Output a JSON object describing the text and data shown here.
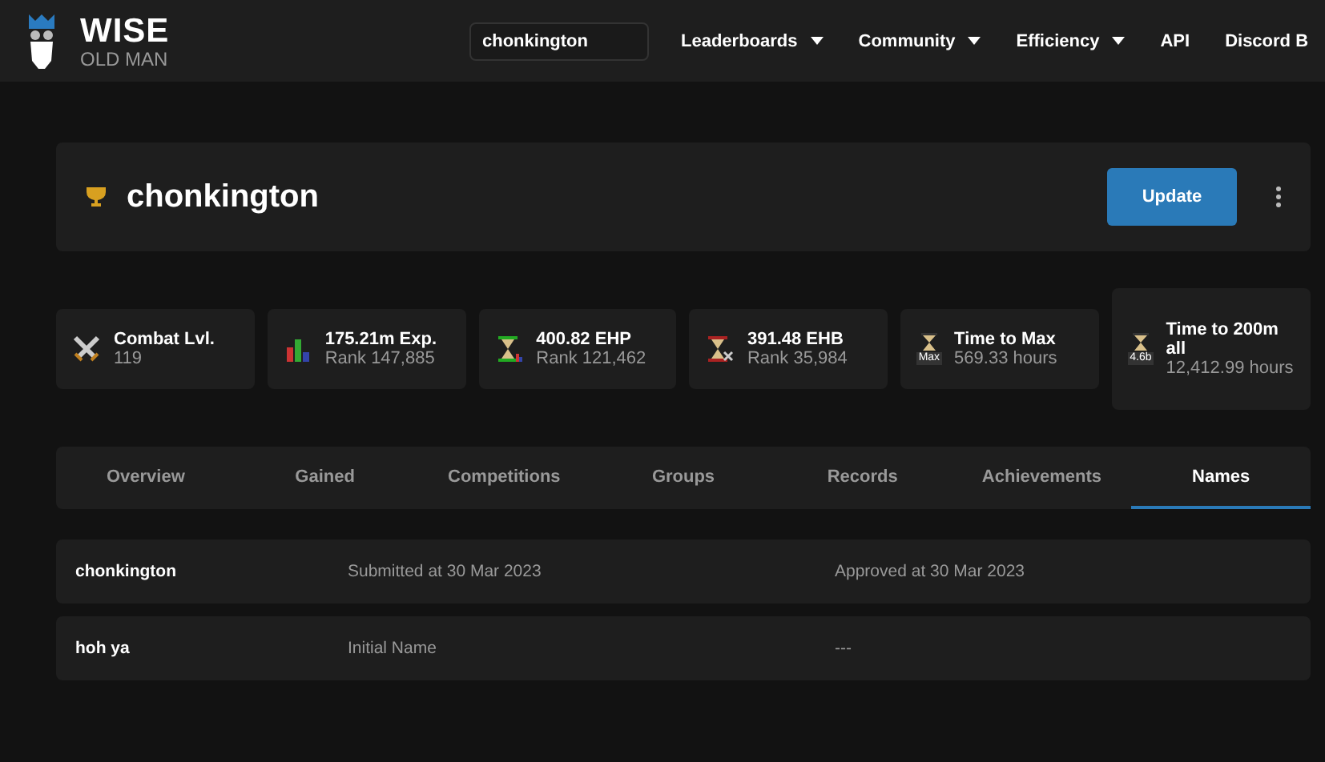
{
  "logo": {
    "title": "WISE",
    "subtitle": "OLD MAN"
  },
  "search": {
    "value": "chonkington"
  },
  "nav": [
    {
      "label": "Leaderboards",
      "dropdown": true
    },
    {
      "label": "Community",
      "dropdown": true
    },
    {
      "label": "Efficiency",
      "dropdown": true
    },
    {
      "label": "API",
      "dropdown": false
    },
    {
      "label": "Discord B",
      "dropdown": false
    }
  ],
  "player": {
    "name": "chonkington",
    "update_button": "Update"
  },
  "stats": [
    {
      "kind": "combat",
      "label": "Combat Lvl.",
      "value": "119"
    },
    {
      "kind": "exp",
      "label": "175.21m Exp.",
      "value": "Rank 147,885"
    },
    {
      "kind": "ehp",
      "label": "400.82 EHP",
      "value": "Rank 121,462"
    },
    {
      "kind": "ehb",
      "label": "391.48 EHB",
      "value": "Rank 35,984"
    },
    {
      "kind": "badge",
      "icon_label": "Max",
      "label": "Time to Max",
      "value": "569.33 hours"
    },
    {
      "kind": "badge",
      "icon_label": "4.6b",
      "label": "Time to 200m all",
      "value": "12,412.99 hours"
    }
  ],
  "tabs": [
    {
      "label": "Overview",
      "selected": false
    },
    {
      "label": "Gained",
      "selected": false
    },
    {
      "label": "Competitions",
      "selected": false
    },
    {
      "label": "Groups",
      "selected": false
    },
    {
      "label": "Records",
      "selected": false
    },
    {
      "label": "Achievements",
      "selected": false
    },
    {
      "label": "Names",
      "selected": true
    }
  ],
  "names": [
    {
      "name": "chonkington",
      "submitted": "Submitted at 30 Mar 2023",
      "approved": "Approved at 30 Mar 2023"
    },
    {
      "name": "hoh ya",
      "submitted": "Initial Name",
      "approved": "---"
    }
  ]
}
